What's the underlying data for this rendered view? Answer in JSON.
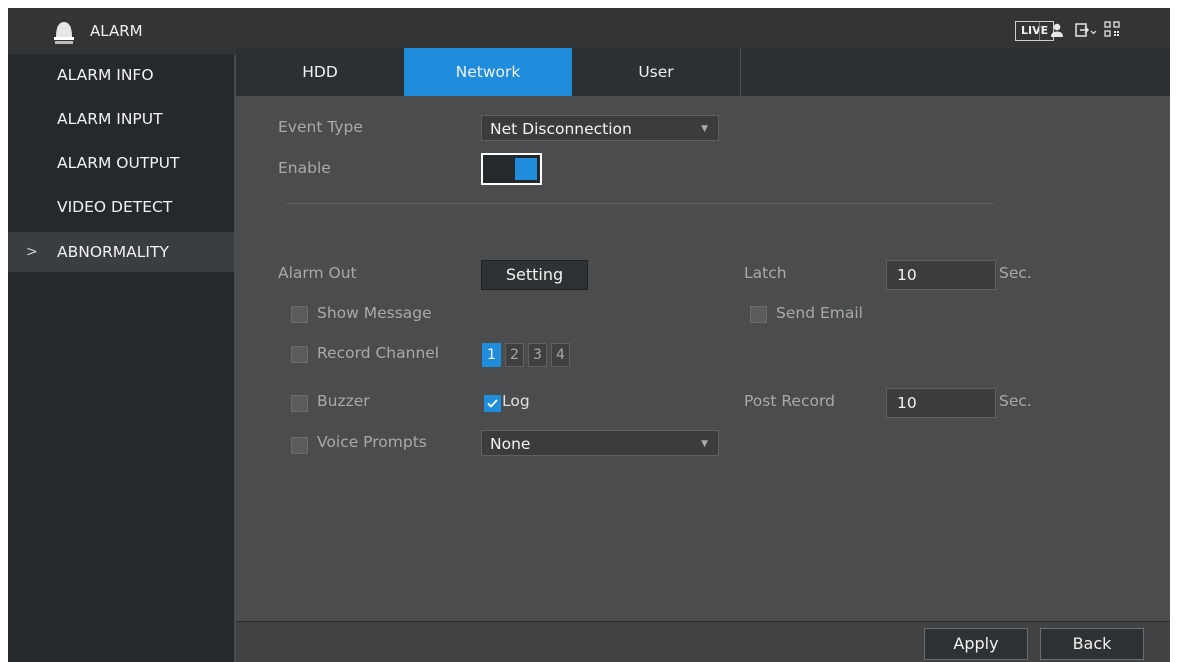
{
  "titlebar": {
    "title": "ALARM",
    "live_label": "LIVE",
    "icons": [
      "alarm-bell-icon",
      "user-icon",
      "logout-icon",
      "qr-code-icon"
    ]
  },
  "sidebar": {
    "items": [
      {
        "label": "ALARM INFO",
        "active": false
      },
      {
        "label": "ALARM INPUT",
        "active": false
      },
      {
        "label": "ALARM OUTPUT",
        "active": false
      },
      {
        "label": "VIDEO DETECT",
        "active": false
      },
      {
        "label": "ABNORMALITY",
        "active": true,
        "marker": ">"
      }
    ]
  },
  "tabs": [
    {
      "label": "HDD",
      "active": false
    },
    {
      "label": "Network",
      "active": true
    },
    {
      "label": "User",
      "active": false
    }
  ],
  "form": {
    "event_type_label": "Event Type",
    "event_type_value": "Net Disconnection",
    "enable_label": "Enable",
    "enable_on": true,
    "alarm_out_label": "Alarm Out",
    "setting_button": "Setting",
    "latch_label": "Latch",
    "latch_value": "10",
    "latch_unit": "Sec.",
    "show_message_label": "Show Message",
    "show_message_checked": false,
    "send_email_label": "Send Email",
    "send_email_checked": false,
    "record_channel_label": "Record Channel",
    "record_channel_checked": false,
    "channels": [
      {
        "label": "1",
        "selected": true
      },
      {
        "label": "2",
        "selected": false
      },
      {
        "label": "3",
        "selected": false
      },
      {
        "label": "4",
        "selected": false
      }
    ],
    "buzzer_label": "Buzzer",
    "buzzer_checked": false,
    "log_label": "Log",
    "log_checked": true,
    "post_record_label": "Post Record",
    "post_record_value": "10",
    "post_record_unit": "Sec.",
    "voice_prompts_label": "Voice Prompts",
    "voice_prompts_checked": false,
    "voice_prompts_value": "None"
  },
  "footer": {
    "apply_label": "Apply",
    "back_label": "Back"
  },
  "colors": {
    "accent": "#1f8ddb",
    "sidebar_bg": "#25292d",
    "panel_bg": "#4b4c4d",
    "titlebar_bg": "#323436"
  }
}
